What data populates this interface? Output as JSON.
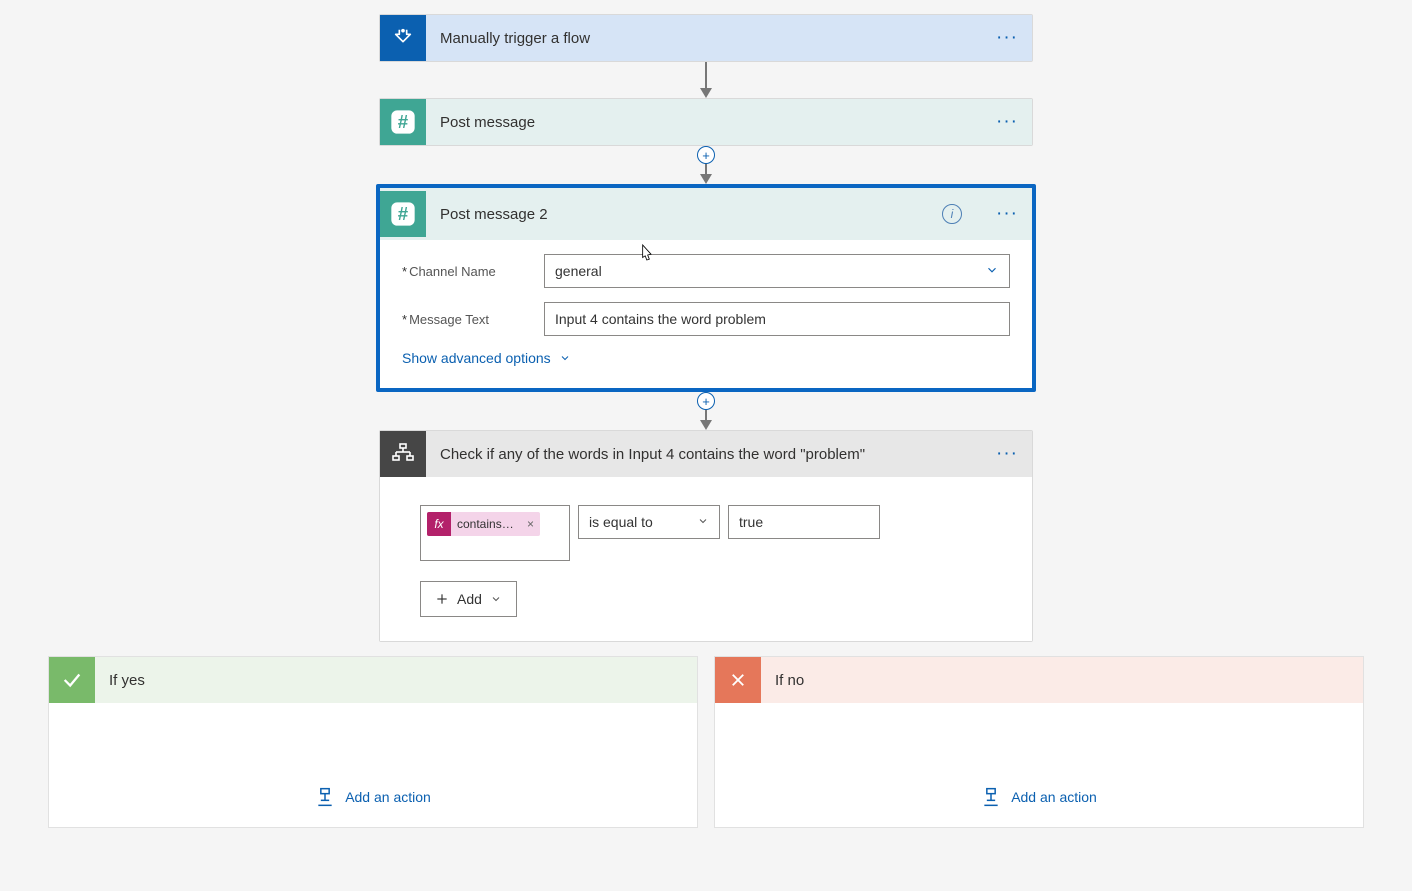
{
  "trigger": {
    "title": "Manually trigger a flow"
  },
  "post1": {
    "title": "Post message"
  },
  "post2": {
    "title": "Post message 2",
    "labels": {
      "channel": "Channel Name",
      "message": "Message Text"
    },
    "values": {
      "channel": "general",
      "message": "Input 4 contains the word problem"
    },
    "advanced": "Show advanced options"
  },
  "condition": {
    "title": "Check if any of the words in Input 4 contains the word \"problem\"",
    "expr": "contains(...",
    "operator": "is equal to",
    "rhs": "true",
    "add": "Add"
  },
  "branch": {
    "yes": "If yes",
    "no": "If no",
    "add_action": "Add an action"
  }
}
